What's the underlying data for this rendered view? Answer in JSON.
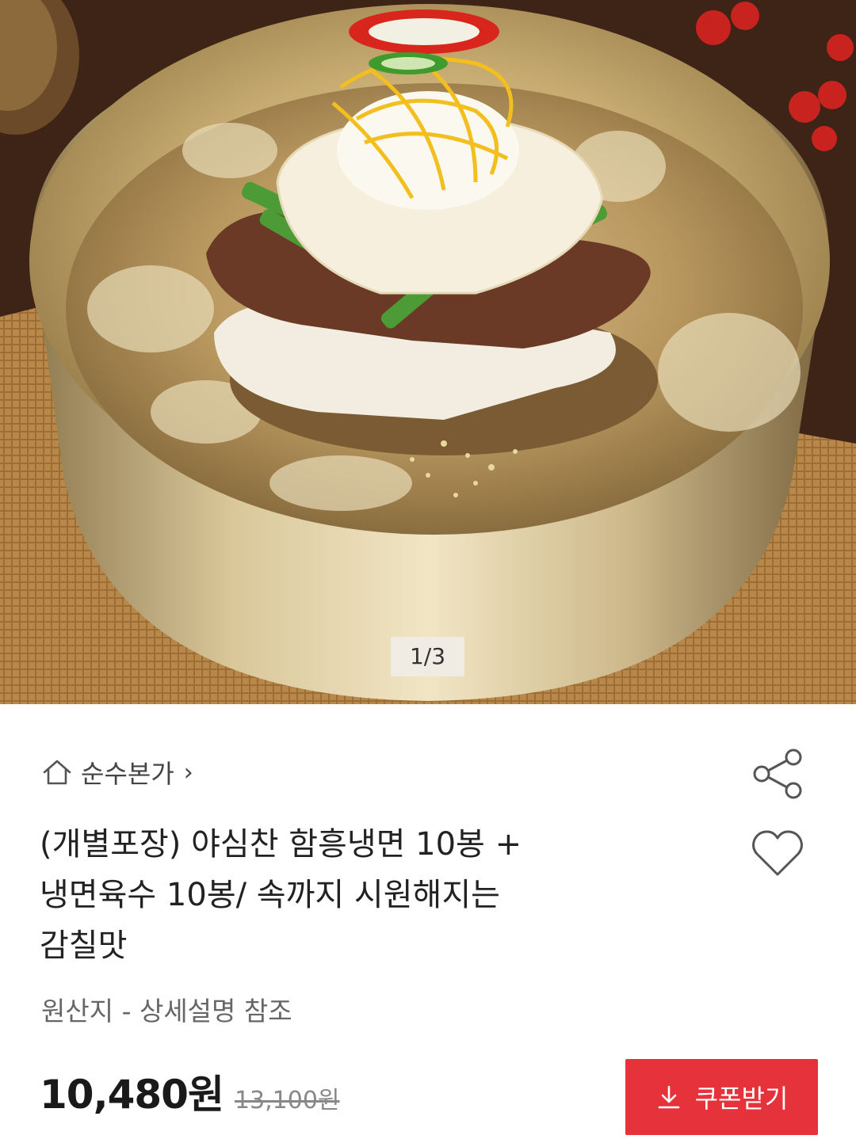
{
  "gallery": {
    "pager_text": "1/3",
    "image_alt": "naengmyeon-bowl-photo"
  },
  "store": {
    "icon": "home-icon",
    "name": "순수본가",
    "chevron": "›"
  },
  "actions": {
    "share_icon": "share-icon",
    "wishlist_icon": "heart-icon"
  },
  "product": {
    "title_lines": [
      "(개별포장) 야심찬 함흥냉면 10봉 +",
      "냉면육수 10봉/  속까지 시원해지는",
      "감칠맛"
    ],
    "origin": "원산지 - 상세설명 참조",
    "price": "10,480원",
    "original_price": "13,100원"
  },
  "coupon_button": {
    "icon": "download-icon",
    "label": "쿠폰받기",
    "color": "#e6323b"
  }
}
